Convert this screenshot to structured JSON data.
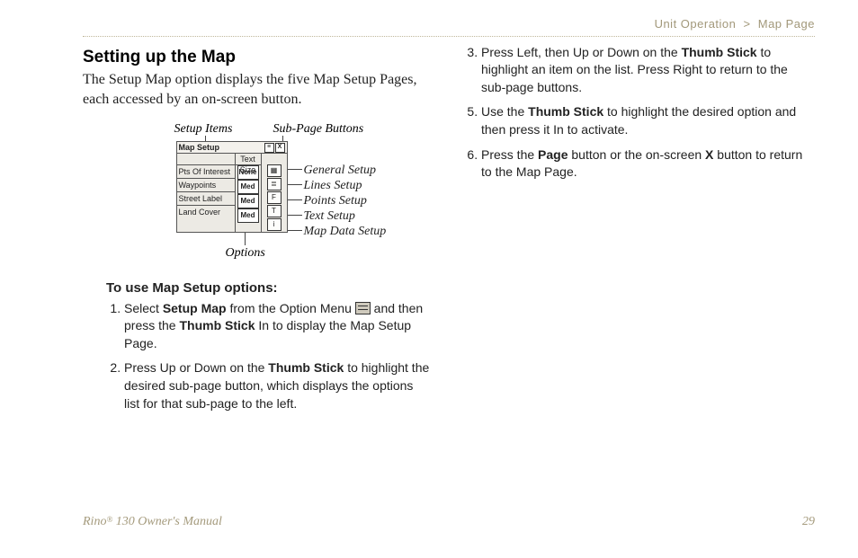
{
  "breadcrumb": {
    "section": "Unit Operation",
    "sep": ">",
    "page": "Map Page"
  },
  "title": "Setting up the Map",
  "intro": "The Setup Map option displays the five Map Setup Pages, each accessed by an on-screen button.",
  "figure": {
    "captions": {
      "setup_items": "Setup Items",
      "subpage": "Sub-Page Buttons",
      "options": "Options"
    },
    "device": {
      "title": "Map Setup",
      "text_size_hdr": "Text Size",
      "rows": [
        {
          "label": "Pts Of Interest",
          "value": "None"
        },
        {
          "label": "Waypoints",
          "value": "Med"
        },
        {
          "label": "Street Label",
          "value": "Med"
        },
        {
          "label": "Land Cover",
          "value": "Med"
        }
      ],
      "right_buttons": [
        "▦",
        "≣",
        "F",
        "T",
        "i"
      ]
    },
    "setups": [
      "General Setup",
      "Lines Setup",
      "Points Setup",
      "Text Setup",
      "Map Data Setup"
    ]
  },
  "subhead": "To use Map Setup options:",
  "steps_left": {
    "1": {
      "pre": "Select ",
      "b1": "Setup Map",
      "mid": " from the Option Menu ",
      "post1": " and then press the ",
      "b2": "Thumb Stick",
      "post2": " In to display the Map Setup Page."
    },
    "2": {
      "pre": "Press Up or Down on the ",
      "b1": "Thumb Stick",
      "post": " to highlight the desired sub-page button, which displays the options list for that sub-page to the left."
    }
  },
  "steps_right": {
    "3": {
      "pre": "Press Left, then Up or Down on the ",
      "b1": "Thumb Stick",
      "post": " to highlight an item on the list. Press Right to return to the sub-page buttons."
    },
    "5": {
      "pre": "Use the ",
      "b1": "Thumb Stick",
      "post": " to highlight the desired option and then press it In to activate."
    },
    "6": {
      "pre": "Press the ",
      "b1": "Page",
      "mid": " button or the on-screen ",
      "b2": "X",
      "post": " button to return to the Map Page."
    }
  },
  "footer": {
    "product_prefix": "Rino",
    "product_reg": "®",
    "product_suffix": " 130 Owner's Manual",
    "page_num": "29"
  }
}
